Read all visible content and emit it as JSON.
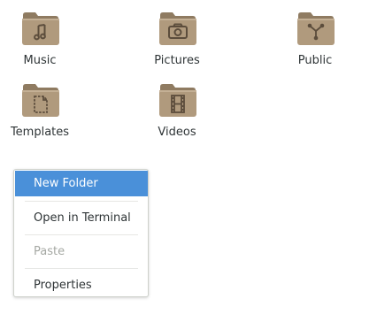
{
  "files": [
    {
      "id": "music",
      "label": "Music",
      "icon": "folder-music-icon"
    },
    {
      "id": "pictures",
      "label": "Pictures",
      "icon": "folder-pictures-icon"
    },
    {
      "id": "public",
      "label": "Public",
      "icon": "folder-public-share-icon"
    },
    {
      "id": "templates",
      "label": "Templates",
      "icon": "folder-templates-icon"
    },
    {
      "id": "videos",
      "label": "Videos",
      "icon": "folder-videos-icon"
    }
  ],
  "context_menu": {
    "items": [
      {
        "label": "New Folder",
        "state": "highlighted"
      },
      {
        "label": "Open in Terminal",
        "state": "enabled"
      },
      {
        "label": "Paste",
        "state": "disabled"
      },
      {
        "label": "Properties",
        "state": "enabled"
      }
    ]
  },
  "colors": {
    "folder_body": "#b09a7d",
    "folder_tab": "#8f7b61",
    "folder_emblem": "#5c4d3c",
    "menu_highlight": "#4a90d9",
    "text": "#2e3436",
    "text_disabled": "#a5a8a3"
  }
}
